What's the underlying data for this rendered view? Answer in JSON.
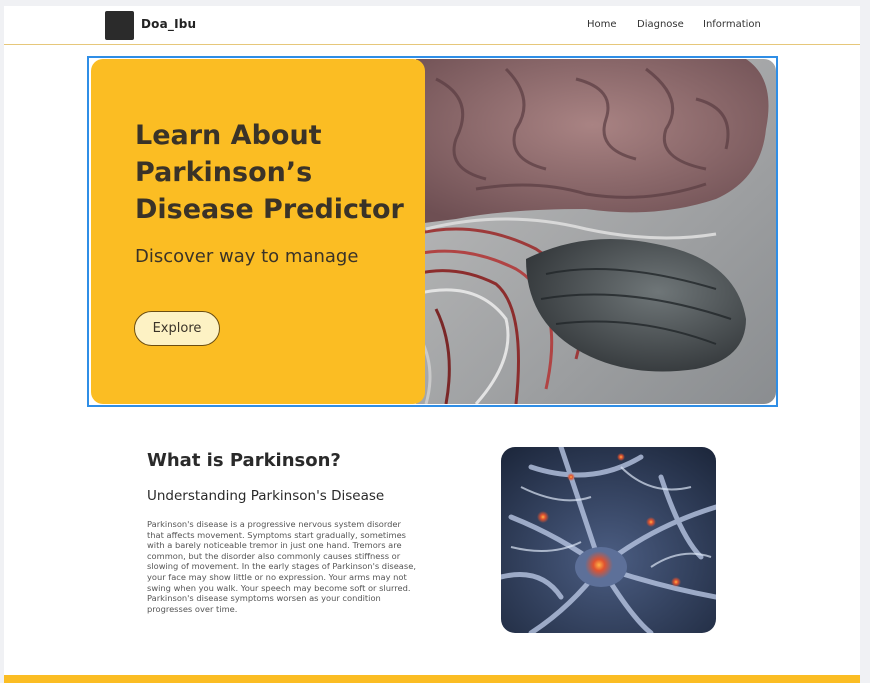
{
  "navbar": {
    "logo_text": "Doa_Ibu",
    "links": [
      "Home",
      "Diagnose",
      "Information"
    ]
  },
  "hero": {
    "title": "Learn About\nParkinson’s\nDisease Predictor",
    "subtitle": "Discover way to manage",
    "button_label": "Explore",
    "accent_color": "#fbbd23"
  },
  "about": {
    "title": "What is Parkinson?",
    "subtitle": "Understanding Parkinson's Disease",
    "body": "Parkinson's disease is a progressive nervous system disorder that affects movement. Symptoms start gradually, sometimes with a barely noticeable tremor in just one hand. Tremors are common, but the disorder also commonly causes stiffness or slowing of movement. In the early stages of Parkinson's disease, your face may show little or no expression. Your arms may not swing when you walk. Your speech may become soft or slurred. Parkinson's disease symptoms worsen as your condition progresses over time."
  }
}
